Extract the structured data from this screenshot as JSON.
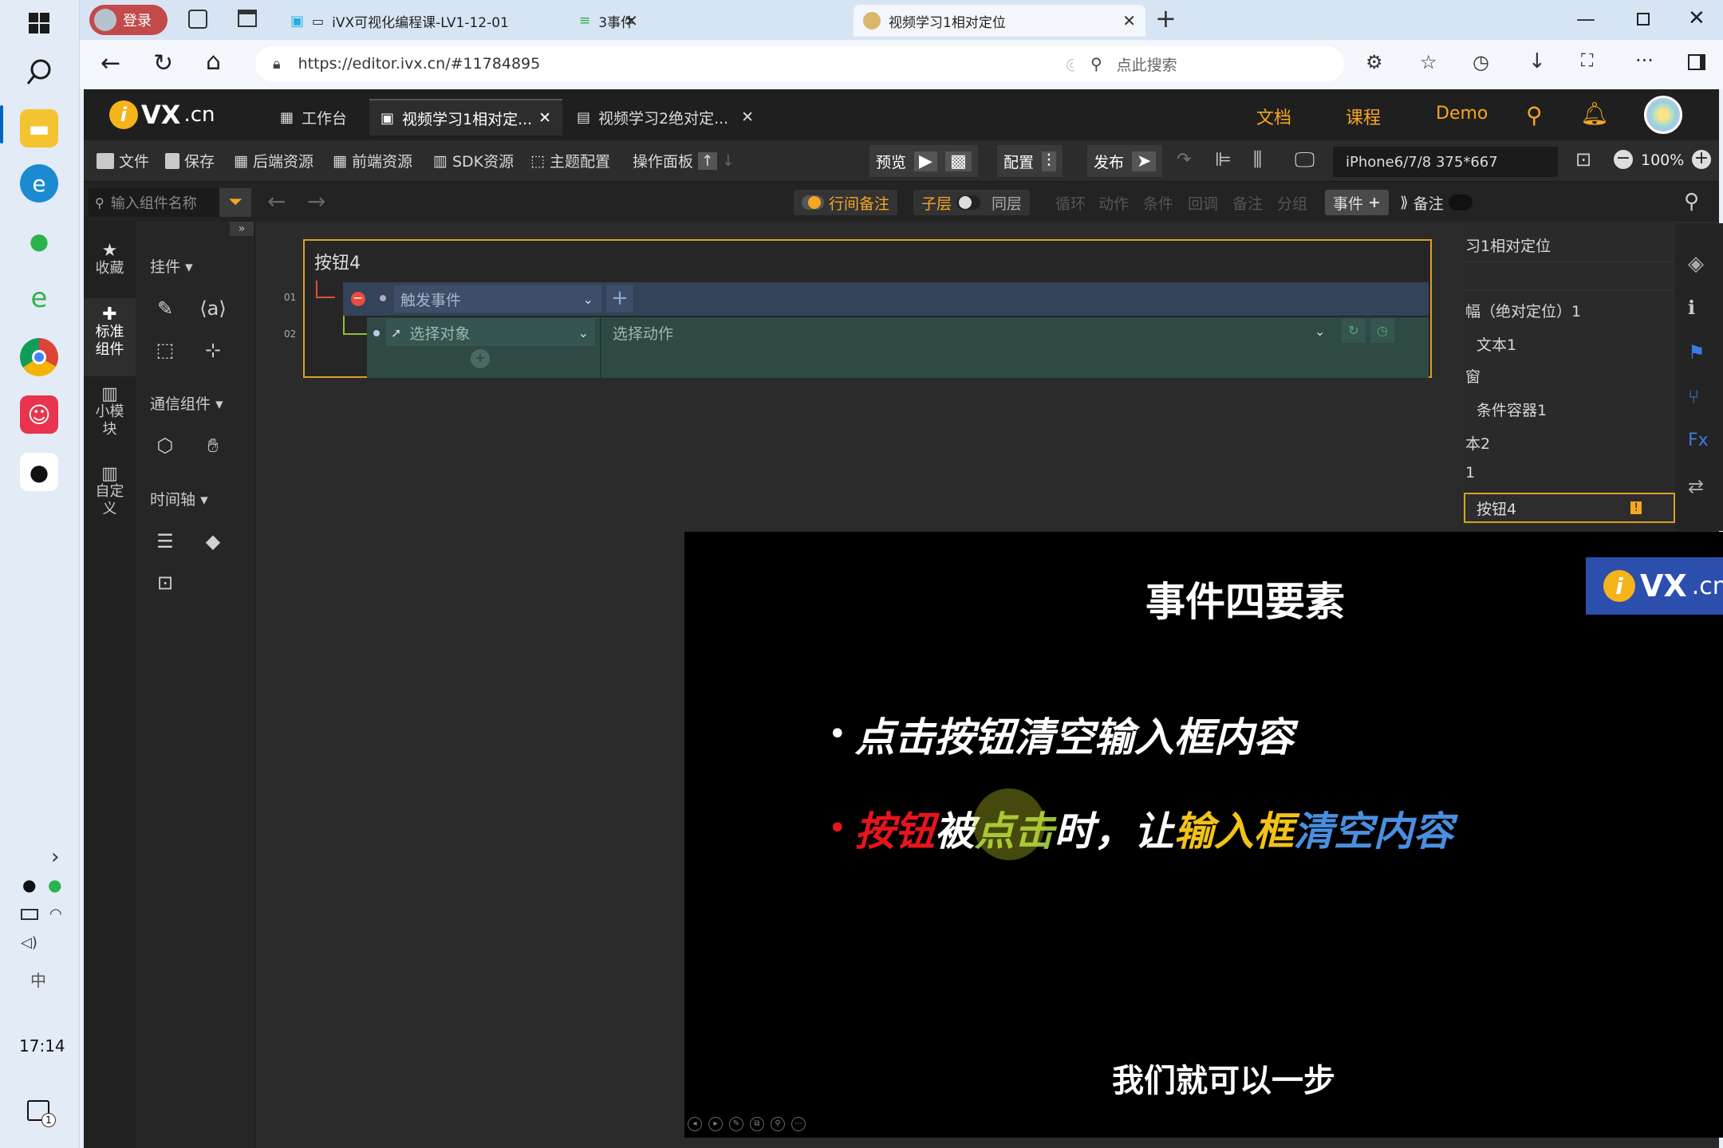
{
  "taskbar": {
    "clock": "17:14",
    "notif_count": "1"
  },
  "browser": {
    "login": "登录",
    "tabs": [
      {
        "label": "iVX可视化编程课-LV1-12-01"
      },
      {
        "label": "3事件"
      },
      {
        "label": "视频学习1相对定位"
      }
    ],
    "url": "https://editor.ivx.cn/#11784895",
    "search_placeholder": "点此搜索"
  },
  "editor": {
    "logo": "VX",
    "logo_suffix": ".cn",
    "tabs": [
      {
        "label": "工作台"
      },
      {
        "label": "视频学习1相对定..."
      },
      {
        "label": "视频学习2绝对定..."
      }
    ],
    "top_links": {
      "docs": "文档",
      "course": "课程",
      "demo": "Demo"
    },
    "toolbar": {
      "file": "文件",
      "save": "保存",
      "backend": "后端资源",
      "frontend": "前端资源",
      "sdk": "SDK资源",
      "theme": "主题配置",
      "ops": "操作面板",
      "preview": "预览",
      "config": "配置",
      "publish": "发布",
      "device": "iPhone6/7/8 375*667",
      "zoom": "100%"
    },
    "subbar": {
      "search_placeholder": "输入组件名称",
      "line_note": "行间备注",
      "child": "子层",
      "same": "同层",
      "loop": "循环",
      "action": "动作",
      "condition": "条件",
      "callback": "回调",
      "note": "备注",
      "group": "分组",
      "event": "事件",
      "note2": "备注"
    },
    "leftnav": [
      {
        "label": "收藏"
      },
      {
        "label": "标准组件"
      },
      {
        "label": "小模块"
      },
      {
        "label": "自定义"
      }
    ],
    "leftpanel": {
      "widgets": "挂件",
      "comm": "通信组件",
      "timeline": "时间轴"
    },
    "event": {
      "title": "按钮4",
      "row1_num": "01",
      "row2_num": "02",
      "trigger": "触发事件",
      "target": "选择对象",
      "action": "选择动作"
    },
    "tree": [
      {
        "label": "习1相对定位"
      },
      {
        "label": "幅（绝对定位）1"
      },
      {
        "label": "文本1"
      },
      {
        "label": "窗"
      },
      {
        "label": "条件容器1"
      },
      {
        "label": "本2"
      },
      {
        "label": "1"
      },
      {
        "label": "按钮4"
      }
    ]
  },
  "video": {
    "brand": "VX",
    "brand_suffix": ".cn",
    "heading": "事件四要素",
    "bullet1": "点击按钮清空输入框内容",
    "bullet2_parts": [
      "按钮",
      "被",
      "点击",
      "时，让",
      "输入框",
      "清空内容"
    ],
    "subtitle": "我们就可以一步",
    "colors": {
      "red": "#e8141d",
      "green": "#9ac33a",
      "yellow": "#f2c218",
      "blue": "#4a8fe0"
    }
  }
}
